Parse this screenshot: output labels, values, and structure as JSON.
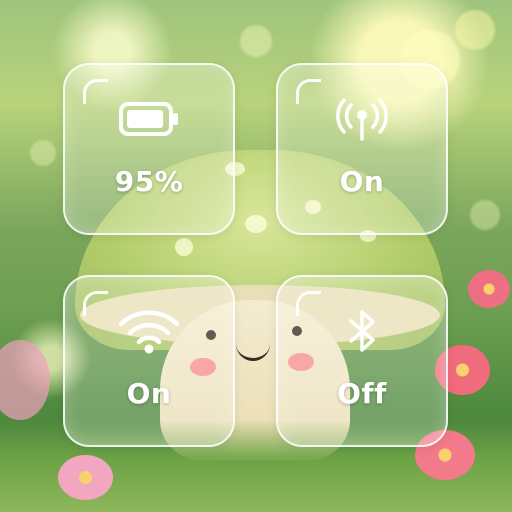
{
  "tiles": {
    "battery": {
      "icon": "battery-icon",
      "value": "95%",
      "level": 0.95
    },
    "cellular": {
      "icon": "cellular-antenna-icon",
      "value": "On"
    },
    "wifi": {
      "icon": "wifi-icon",
      "value": "On"
    },
    "bluetooth": {
      "icon": "bluetooth-icon",
      "value": "Off"
    }
  },
  "colors": {
    "tile_text": "#ffffff",
    "tile_border": "#ffffff"
  }
}
